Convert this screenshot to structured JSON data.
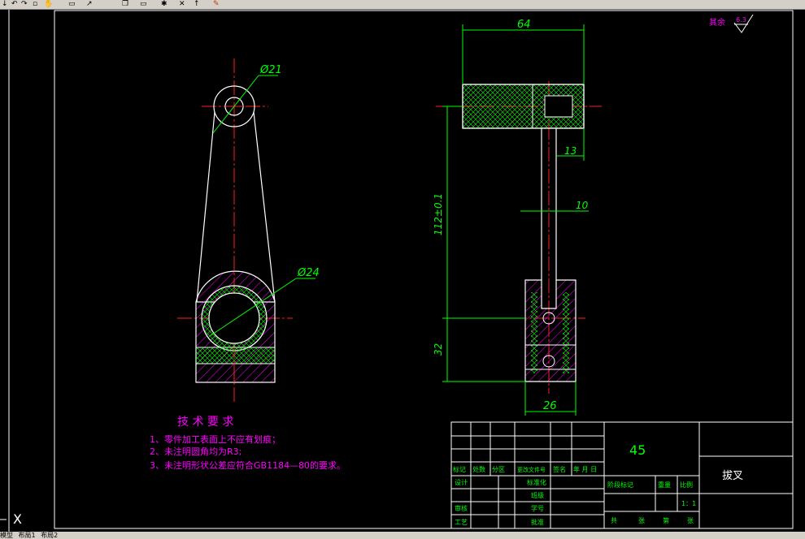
{
  "toolbar": {
    "icons": [
      "arrow-icon",
      "undo-icon",
      "redo-icon",
      "cursor-icon",
      "pan-icon",
      "window-icon",
      "copy-icon",
      "star-icon",
      "pointer-icon",
      "close-icon",
      "paint-icon"
    ]
  },
  "drawing": {
    "dimensions": {
      "top_diameter": "Ø21",
      "bottom_diameter": "Ø24",
      "width_64": "64",
      "dim_13": "13",
      "dim_10": "10",
      "height_112": "112±0.1",
      "height_32": "32",
      "width_26": "26"
    },
    "surface_finish": {
      "label": "其余",
      "value": "6.3"
    },
    "technical_requirements": {
      "title": "技 术 要 求",
      "items": [
        "1、零件加工表面上不应有划痕；",
        "2、未注明圆角均为R3;",
        "3、未注明形状公差应符合GB1184—80的要求。"
      ]
    },
    "title_block": {
      "material": "45",
      "part_name": "拔叉",
      "scale": "1：1",
      "row_labels": [
        "标记",
        "处数",
        "分区",
        "更改文件号",
        "签名",
        "年 月 日"
      ],
      "left_labels": [
        "设计",
        "审核",
        "工艺"
      ],
      "mid_labels": [
        "标准化",
        "班级",
        "学号",
        "批准"
      ],
      "right_labels": [
        "阶段标记",
        "重量",
        "比例"
      ],
      "sheet_labels": [
        "共",
        "张",
        "第",
        "张"
      ]
    },
    "colors": {
      "outline": "#ffffff",
      "centerline": "#ff2020",
      "dimension": "#00ff00",
      "hatch": "#ff00ff",
      "text": "#ff00ff"
    }
  },
  "statusbar": {
    "tabs": [
      "模型",
      "布局1",
      "布局2"
    ]
  }
}
